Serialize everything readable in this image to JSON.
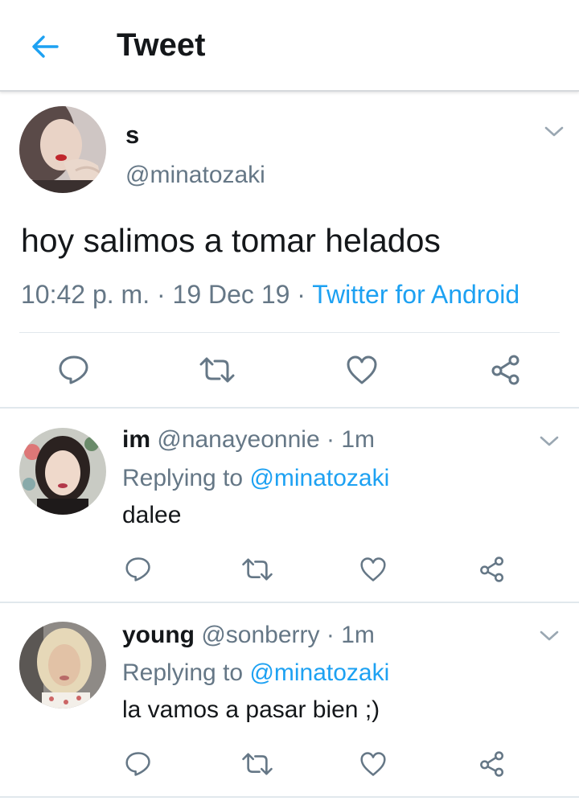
{
  "header": {
    "title": "Tweet"
  },
  "main_tweet": {
    "name": "s",
    "handle": "@minatozaki",
    "text": "hoy salimos a tomar helados",
    "time": "10:42 p. m.",
    "dot1": " · ",
    "date": "19 Dec 19",
    "dot2": " · ",
    "source": "Twitter for Android"
  },
  "replies": [
    {
      "name": "im",
      "handle": "@nanayeonnie",
      "time_sep": " · ",
      "time": "1m",
      "replying_prefix": "Replying to ",
      "replying_to": "@minatozaki",
      "text": "dalee"
    },
    {
      "name": "young",
      "handle": "@sonberry",
      "time_sep": " · ",
      "time": "1m",
      "replying_prefix": "Replying to ",
      "replying_to": "@minatozaki",
      "text": "la vamos a pasar bien ;)"
    }
  ],
  "icons": [
    "back-arrow-icon",
    "chevron-down-icon",
    "reply-icon",
    "retweet-icon",
    "like-icon",
    "share-icon"
  ],
  "colors": {
    "accent": "#1da1f2",
    "secondary_text": "#657786",
    "icon_gray": "#657786",
    "divider": "#e1e8ed"
  }
}
